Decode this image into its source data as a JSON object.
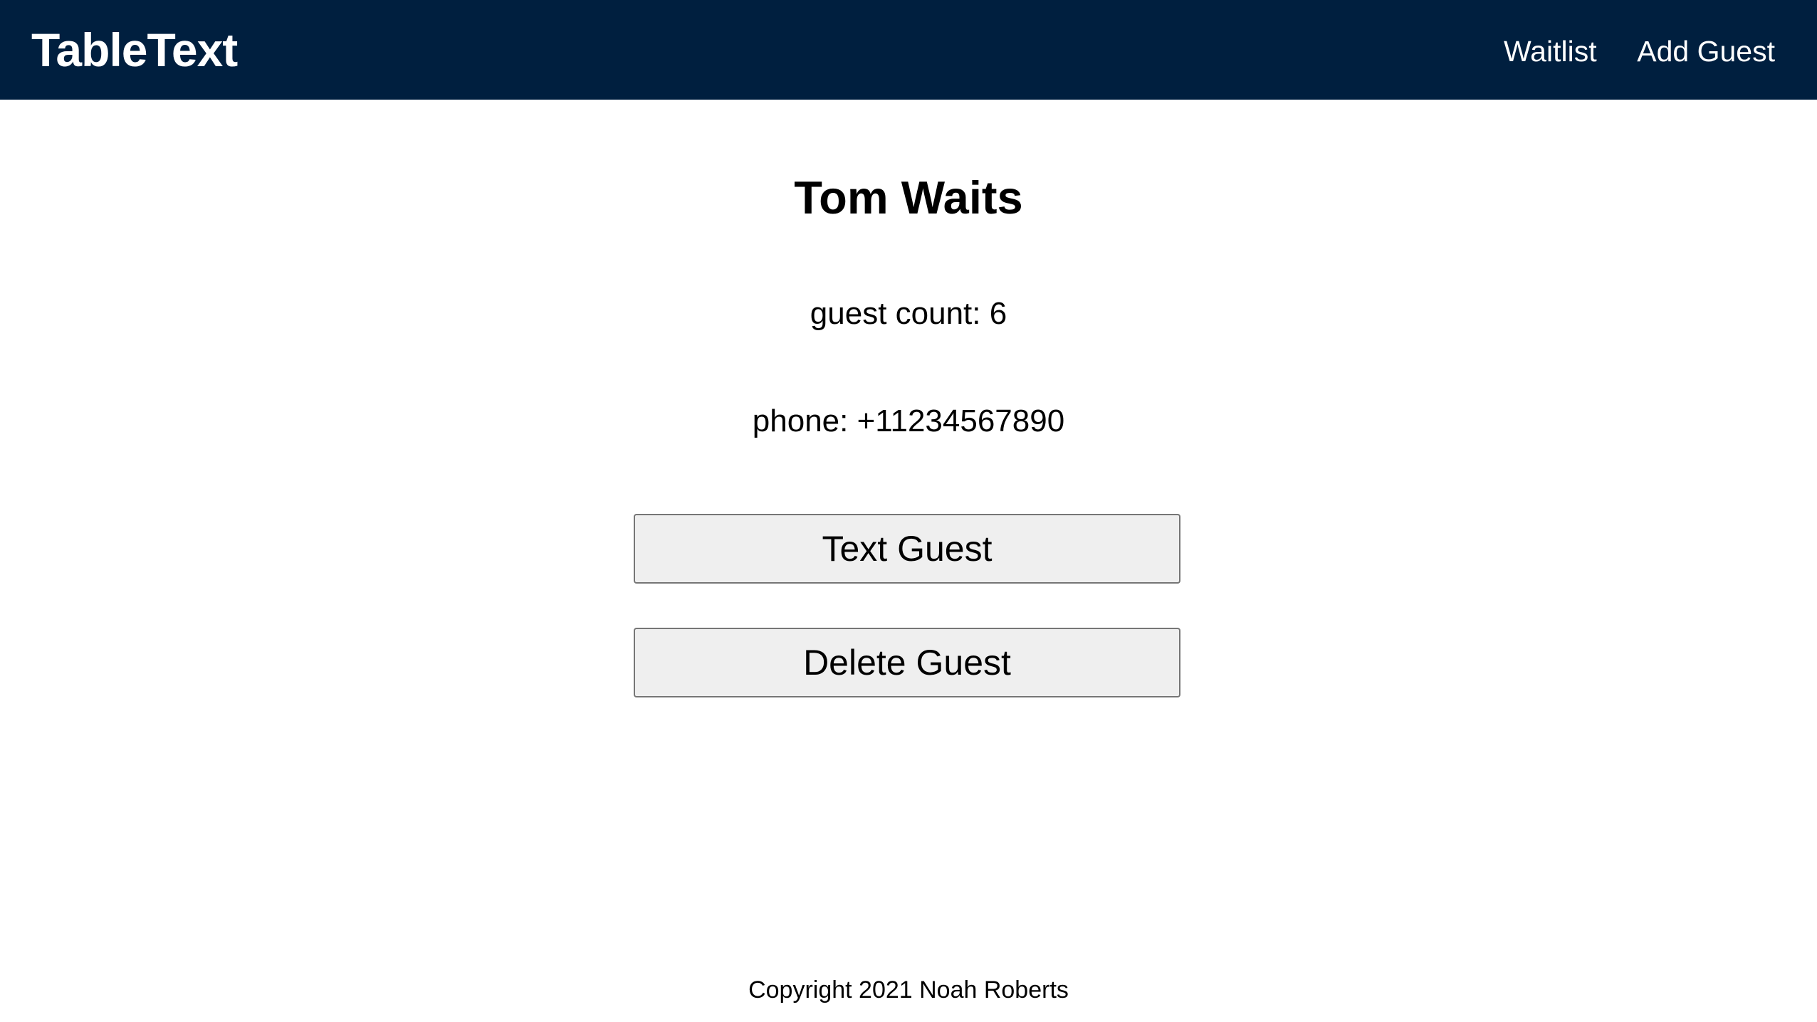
{
  "navbar": {
    "brand": "TableText",
    "links": [
      {
        "label": "Waitlist"
      },
      {
        "label": "Add Guest"
      }
    ],
    "background_color": "#001f3f"
  },
  "guest": {
    "name": "Tom Waits",
    "guest_count_text": "guest count: 6",
    "phone_text": "phone: +11234567890"
  },
  "actions": {
    "text_guest_label": "Text Guest",
    "delete_guest_label": "Delete Guest"
  },
  "footer": {
    "copyright": "Copyright 2021 Noah Roberts"
  }
}
